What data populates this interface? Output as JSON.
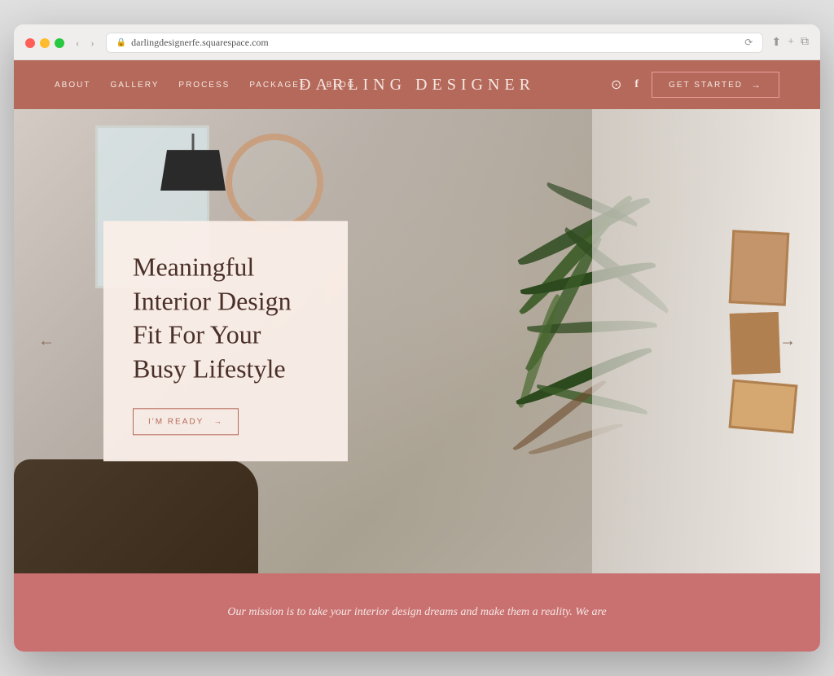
{
  "browser": {
    "url": "darlingdesignerfe.squarespace.com",
    "reload_label": "⟳"
  },
  "nav": {
    "links": [
      {
        "label": "ABOUT",
        "id": "about"
      },
      {
        "label": "GALLERY",
        "id": "gallery"
      },
      {
        "label": "PROCESS",
        "id": "process"
      },
      {
        "label": "PACKAGES",
        "id": "packages"
      },
      {
        "label": "BLOG",
        "id": "blog"
      }
    ],
    "brand": "DARLING DESIGNER",
    "cta": "GET STARTED",
    "cta_arrow": "→"
  },
  "hero": {
    "heading_line1": "Meaningful",
    "heading_line2": "Interior Design",
    "heading_line3": "Fit For Your",
    "heading_line4": "Busy Lifestyle",
    "cta_label": "I'M READY",
    "cta_arrow": "→",
    "arrow_left": "←",
    "arrow_right": "→"
  },
  "mission": {
    "text": "Our mission is to take your interior design dreams and make them a reality. We are"
  }
}
